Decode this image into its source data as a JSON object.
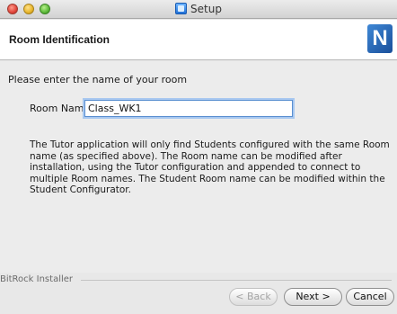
{
  "window": {
    "title": "Setup"
  },
  "header": {
    "title": "Room Identification",
    "logo_letter": "N"
  },
  "content": {
    "prompt": "Please enter the name of your room",
    "room_name_label": "Room Name",
    "room_name_value": "Class_WK1",
    "info_text": "The Tutor application will only find Students configured with the same Room name (as specified above).  The Room name can be modified after installation, using the Tutor configuration and appended to connect to multiple Room names.  The Student Room name can be modified within the Student Configurator."
  },
  "footer": {
    "installer_label": "BitRock Installer",
    "back_label": "< Back",
    "next_label": "Next >",
    "cancel_label": "Cancel"
  }
}
